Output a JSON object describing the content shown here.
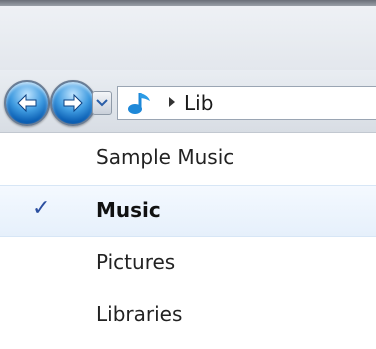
{
  "address_bar": {
    "location_icon": "music-note-icon",
    "crumb_text": "Lib",
    "crumb_arrow_icon": "breadcrumb-arrow-icon"
  },
  "navigation": {
    "back_icon": "back-arrow-icon",
    "forward_icon": "forward-arrow-icon",
    "history_icon": "chevron-down-icon"
  },
  "history_menu": {
    "items": [
      {
        "label": "Sample Music",
        "selected": false
      },
      {
        "label": "Music",
        "selected": true,
        "mark": "✓"
      },
      {
        "label": "Pictures",
        "selected": false
      },
      {
        "label": "Libraries",
        "selected": false
      }
    ]
  },
  "colors": {
    "nav_button": "#3f9be0",
    "selected_row": "#e6f0fb",
    "check_mark": "#2b4fa0"
  }
}
